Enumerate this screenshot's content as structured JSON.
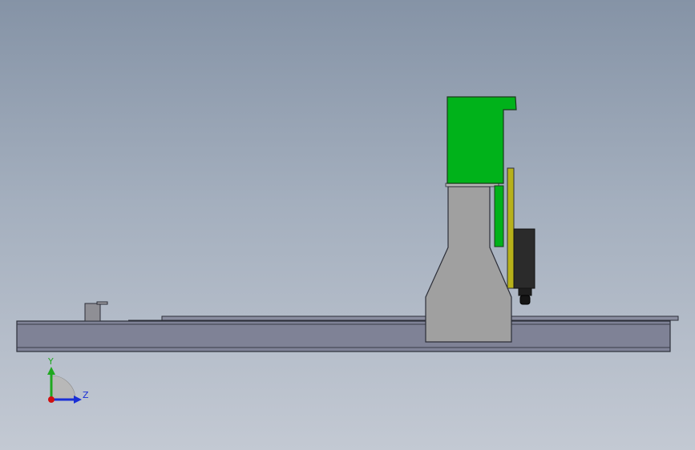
{
  "viewport": {
    "background_top": "#8593a6",
    "background_bottom": "#c3c9d3"
  },
  "colors": {
    "base_rail": "#7f8296",
    "base_edge": "#2c2e38",
    "gantry_body": "#a0a0a0",
    "head_block": "#00b21a",
    "yellow_plate": "#b7b11a",
    "motor": "#2b2b2b"
  },
  "triad": {
    "y_label": "Y",
    "z_label": "Z",
    "y_axis_color": "#1fa81f",
    "z_axis_color": "#1a2fd6",
    "origin_color": "#d01010"
  }
}
